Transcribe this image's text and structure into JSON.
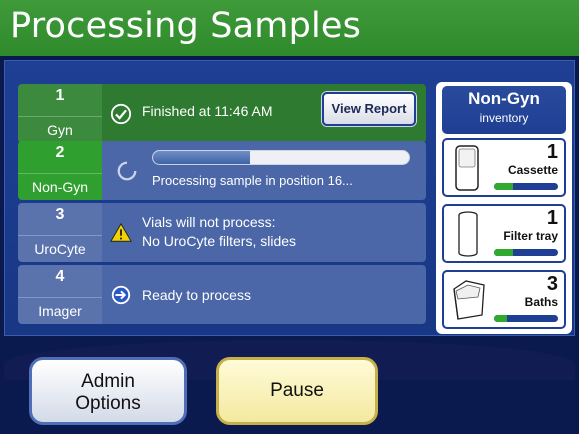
{
  "header": {
    "title": "Processing Samples"
  },
  "rows": [
    {
      "number": "1",
      "label": "Gyn",
      "status": "Finished at  11:46 AM",
      "button": "View Report"
    },
    {
      "number": "2",
      "label": "Non-Gyn",
      "status": "Processing sample in position 16...",
      "progress": 0.38
    },
    {
      "number": "3",
      "label": "UroCyte",
      "status_line1": "Vials will not process:",
      "status_line2": "No UroCyte filters, slides"
    },
    {
      "number": "4",
      "label": "Imager",
      "status": "Ready to process"
    }
  ],
  "inventory": {
    "title": "Non-Gyn",
    "subtitle": "inventory",
    "items": [
      {
        "count": "1",
        "name": "Cassette",
        "level": 0.3
      },
      {
        "count": "1",
        "name": "Filter tray",
        "level": 0.3
      },
      {
        "count": "3",
        "name": "Baths",
        "level": 0.2
      }
    ]
  },
  "buttons": {
    "admin_line1": "Admin",
    "admin_line2": "Options",
    "pause": "Pause"
  },
  "colors": {
    "header_green": "#3f9a3a",
    "navy": "#0a1a4e",
    "panel_blue": "#1e3f94",
    "active_green": "#2fa02f"
  }
}
